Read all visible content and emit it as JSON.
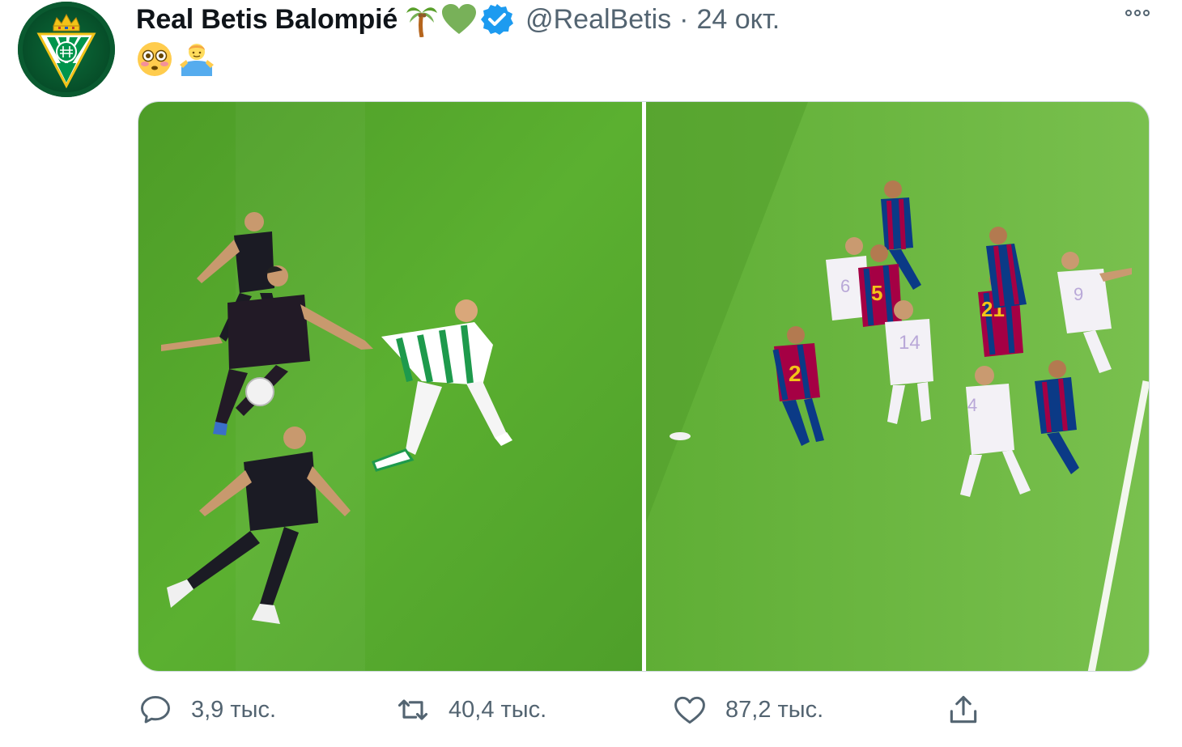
{
  "tweet": {
    "display_name": "Real Betis Balompié",
    "name_emojis": [
      "palm-tree",
      "green-heart"
    ],
    "verified": true,
    "handle": "@RealBetis",
    "separator": "·",
    "date": "24 окт.",
    "text_emojis": [
      "flushed-face",
      "person-shrugging"
    ]
  },
  "media": {
    "photos": [
      {
        "scene": "left"
      },
      {
        "scene": "right"
      }
    ]
  },
  "actions": {
    "reply_count": "3,9 тыс.",
    "retweet_count": "40,4 тыс.",
    "like_count": "87,2 тыс."
  },
  "colors": {
    "text_primary": "#0f1419",
    "text_secondary": "#536471",
    "verified_blue": "#1d9bf0",
    "betis_green": "#00954c",
    "pitch_green": "#58b02f"
  }
}
